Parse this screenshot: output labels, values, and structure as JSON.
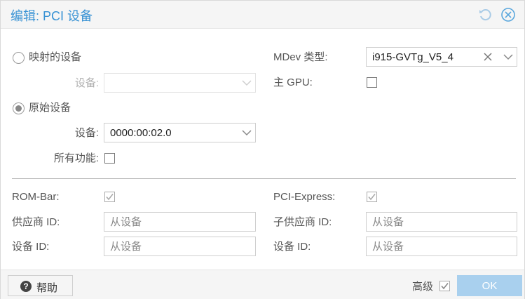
{
  "window": {
    "title": "编辑: PCI 设备"
  },
  "mapped": {
    "radio_label": "映射的设备",
    "selected": false,
    "device_label": "设备:",
    "device_value": ""
  },
  "raw": {
    "radio_label": "原始设备",
    "selected": true,
    "device_label": "设备:",
    "device_value": "0000:00:02.0",
    "all_functions_label": "所有功能:",
    "all_functions_checked": false
  },
  "mdev": {
    "label": "MDev 类型:",
    "value": "i915-GVTg_V5_4"
  },
  "primary_gpu": {
    "label": "主 GPU:",
    "checked": false
  },
  "advanced": {
    "rombar_label": "ROM-Bar:",
    "rombar_checked": true,
    "pcie_label": "PCI-Express:",
    "pcie_checked": true,
    "vendor_id_label": "供应商 ID:",
    "vendor_id_placeholder": "从设备",
    "sub_vendor_id_label": "子供应商 ID:",
    "sub_vendor_id_placeholder": "从设备",
    "device_id_label": "设备 ID:",
    "device_id_placeholder": "从设备",
    "sub_device_id_label": "设备 ID:",
    "sub_device_id_placeholder": "从设备"
  },
  "footer": {
    "help_label": "帮助",
    "advanced_label": "高级",
    "advanced_checked": true,
    "ok_label": "OK"
  },
  "colors": {
    "accent": "#3892d4",
    "ok_button": "#a9d0ee"
  },
  "icons": {
    "reset": "reset-icon",
    "close": "close-circle-icon",
    "dropdown": "chevron-down-icon",
    "clear": "clear-x-icon",
    "help": "question-circle-icon"
  }
}
